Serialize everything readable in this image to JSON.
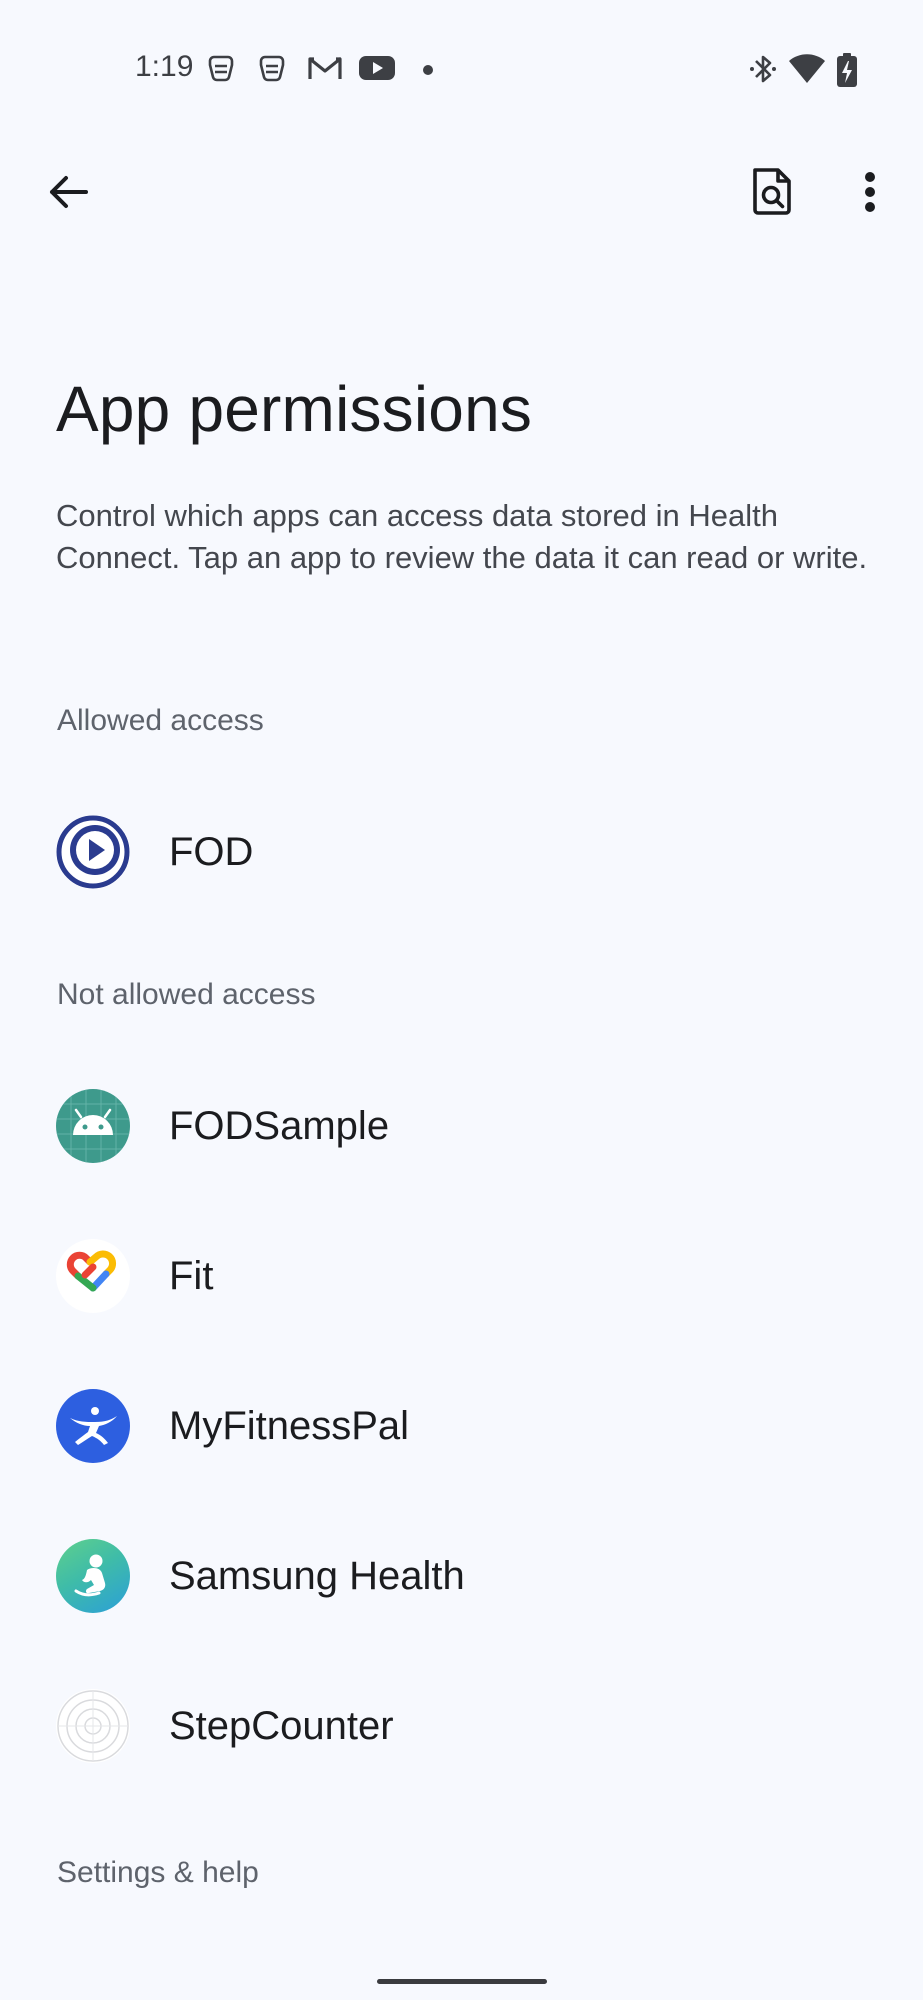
{
  "status_bar": {
    "time": "1:19",
    "left_icons": [
      "app-notification-icon",
      "app-notification-icon",
      "gmail-icon",
      "youtube-icon",
      "more-notifications-dot-icon"
    ],
    "right_icons": [
      "bluetooth-icon",
      "wifi-icon",
      "battery-charging-icon"
    ]
  },
  "top_bar": {
    "back_icon": "arrow-back-icon",
    "search_icon": "document-search-icon",
    "more_icon": "more-vert-icon"
  },
  "page": {
    "title": "App permissions",
    "description": "Control which apps can access data stored in Health Connect. Tap an app to review the data it can read or write."
  },
  "sections": {
    "allowed_header": "Allowed access",
    "allowed_apps": [
      {
        "name": "FOD",
        "icon": "fod-play-icon"
      }
    ],
    "not_allowed_header": "Not allowed access",
    "not_allowed_apps": [
      {
        "name": "FODSample",
        "icon": "android-icon"
      },
      {
        "name": "Fit",
        "icon": "google-fit-heart-icon"
      },
      {
        "name": "MyFitnessPal",
        "icon": "myfitnesspal-icon"
      },
      {
        "name": "Samsung Health",
        "icon": "samsung-health-icon"
      },
      {
        "name": "StepCounter",
        "icon": "stepcounter-icon"
      }
    ],
    "settings_header": "Settings & help"
  },
  "colors": {
    "background": "#f7f9fe",
    "text_primary": "#1b1c1f",
    "text_secondary": "#44474e",
    "section_header": "#5e636c",
    "fod_blue": "#2a3b8f",
    "android_teal": "#3e9a8c",
    "myfitnesspal_blue": "#2d5fe0",
    "samsung_health_green": "#4fc08d"
  }
}
